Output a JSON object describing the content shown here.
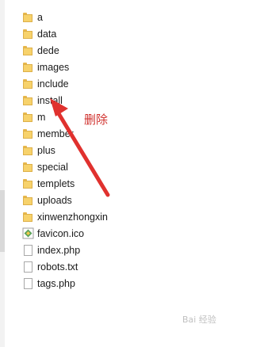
{
  "files": [
    {
      "name": "a",
      "type": "folder",
      "icon": "folder-icon"
    },
    {
      "name": "data",
      "type": "folder",
      "icon": "folder-icon"
    },
    {
      "name": "dede",
      "type": "folder",
      "icon": "folder-icon"
    },
    {
      "name": "images",
      "type": "folder",
      "icon": "folder-icon"
    },
    {
      "name": "include",
      "type": "folder",
      "icon": "folder-icon"
    },
    {
      "name": "install",
      "type": "folder",
      "icon": "folder-icon"
    },
    {
      "name": "m",
      "type": "folder",
      "icon": "folder-icon"
    },
    {
      "name": "member",
      "type": "folder",
      "icon": "folder-icon"
    },
    {
      "name": "plus",
      "type": "folder",
      "icon": "folder-icon"
    },
    {
      "name": "special",
      "type": "folder",
      "icon": "folder-icon"
    },
    {
      "name": "templets",
      "type": "folder",
      "icon": "folder-icon"
    },
    {
      "name": "uploads",
      "type": "folder",
      "icon": "folder-icon"
    },
    {
      "name": "xinwenzhongxin",
      "type": "folder",
      "icon": "folder-icon"
    },
    {
      "name": "favicon.ico",
      "type": "ico",
      "icon": "ico-file-icon"
    },
    {
      "name": "index.php",
      "type": "file",
      "icon": "file-icon"
    },
    {
      "name": "robots.txt",
      "type": "file",
      "icon": "file-icon"
    },
    {
      "name": "tags.php",
      "type": "file",
      "icon": "file-icon"
    }
  ],
  "annotation": {
    "text": "删除",
    "color": "#d0312d",
    "target": "install"
  },
  "watermark": {
    "text": "Bai 经验"
  }
}
